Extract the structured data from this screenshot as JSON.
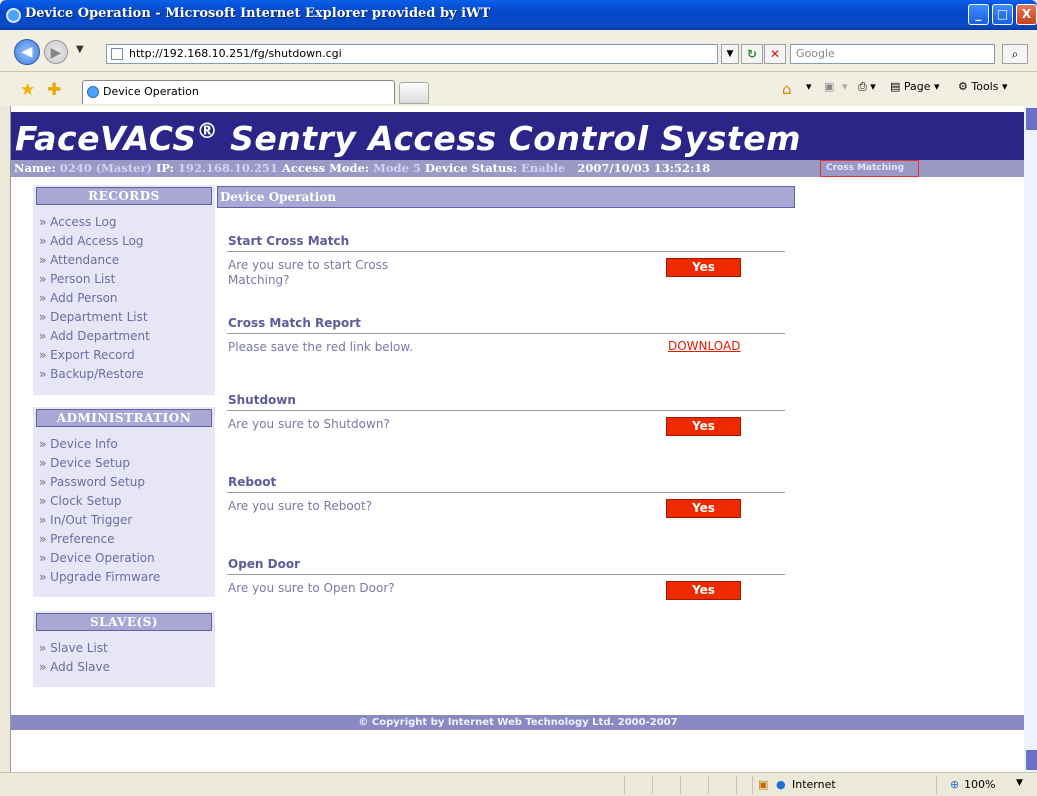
{
  "window": {
    "title": "Device Operation - Microsoft Internet Explorer provided by iWT",
    "minimize": "_",
    "maximize": "□",
    "close": "X"
  },
  "browser": {
    "url": "http://192.168.10.251/fg/shutdown.cgi",
    "search_placeholder": "Google",
    "tab_title": "Device Operation",
    "page_menu": "Page",
    "tools_menu": "Tools",
    "zone": "Internet",
    "zoom": "100%"
  },
  "header": {
    "brand": "FaceVACS",
    "registered": "®",
    "brand_rest": " Sentry Access Control System",
    "name_label": "Name:",
    "name_value": "0240 (Master)",
    "ip_label": "IP:",
    "ip_value": "192.168.10.251",
    "access_label": "Access Mode:",
    "access_value": "Mode 5",
    "status_label": "Device Status:",
    "status_value": "Enable",
    "datetime": "2007/10/03 13:52:18",
    "cross_matching": "Cross Matching"
  },
  "sidebar": {
    "records_title": "RECORDS",
    "records": [
      "» Access Log",
      "» Add Access Log",
      "» Attendance",
      "» Person List",
      "» Add Person",
      "» Department List",
      "» Add Department",
      "» Export Record",
      "» Backup/Restore"
    ],
    "admin_title": "ADMINISTRATION",
    "admin": [
      "» Device Info",
      "» Device Setup",
      "» Password Setup",
      "» Clock Setup",
      "» In/Out Trigger",
      "» Preference",
      "» Device Operation",
      "» Upgrade Firmware"
    ],
    "slave_title": "SLAVE(S)",
    "slave": [
      "» Slave List",
      "» Add Slave"
    ]
  },
  "main": {
    "heading": "Device Operation",
    "sections": [
      {
        "title": "Start Cross Match",
        "desc": "Are you sure to start Cross Matching?",
        "action": "Yes"
      },
      {
        "title": "Cross Match Report",
        "desc": "Please save the red link below.",
        "action": "DOWNLOAD"
      },
      {
        "title": "Shutdown",
        "desc": "Are you sure to Shutdown?",
        "action": "Yes"
      },
      {
        "title": "Reboot",
        "desc": "Are you sure to Reboot?",
        "action": "Yes"
      },
      {
        "title": "Open Door",
        "desc": "Are you sure to Open Door?",
        "action": "Yes"
      }
    ]
  },
  "footer": "© Copyright by Internet Web Technology Ltd. 2000-2007"
}
